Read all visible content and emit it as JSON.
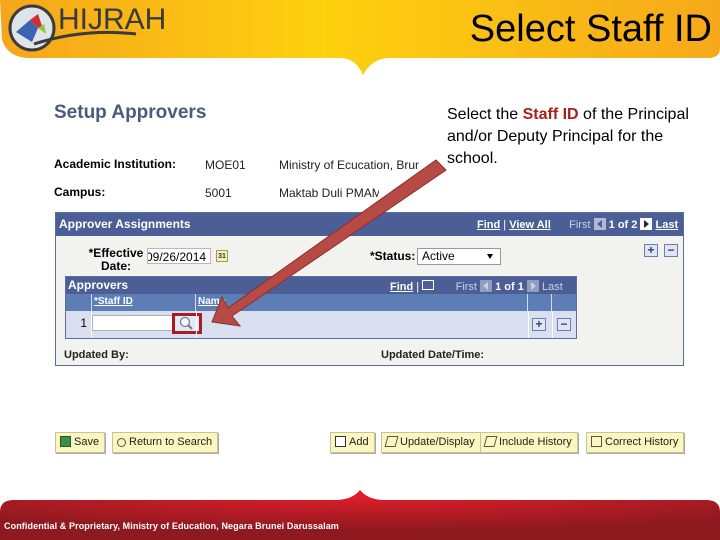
{
  "slide": {
    "logo_text": "HIJRAH",
    "title": "Select Staff ID",
    "footer": "Confidential & Proprietary, Ministry of Education, Negara Brunei Darussalam",
    "callout": {
      "before": "Select the ",
      "highlight": "Staff ID",
      "after": " of the Principal and/or Deputy Principal for the school."
    },
    "colors": {
      "header_yellow": "#fcc30f",
      "footer_red": "#c81e27",
      "highlight_red": "#a8201a",
      "arrow_red": "#b84a45"
    }
  },
  "page": {
    "title": "Setup Approvers",
    "academic_institution": {
      "label": "Academic Institution:",
      "code": "MOE01",
      "name": "Ministry of Ecucation, Brunei"
    },
    "campus": {
      "label": "Campus:",
      "code": "5001",
      "name": "Maktab Duli PMAMB"
    }
  },
  "assignments": {
    "title": "Approver Assignments",
    "find": "Find",
    "view_all": "View All",
    "first": "First",
    "counter": "1 of 2",
    "last": "Last",
    "effective_date_label": "*Effective Date:",
    "effective_date_value": "09/26/2014",
    "calendar_icon_text": "31",
    "status_label": "*Status:",
    "status_value": "Active",
    "add_row": "+",
    "delete_row": "−",
    "updated_by_label": "Updated By:",
    "updated_datetime_label": "Updated Date/Time:"
  },
  "approvers": {
    "title": "Approvers",
    "find": "Find",
    "first": "First",
    "counter": "1 of 1",
    "last": "Last",
    "columns": [
      "*Staff ID",
      "Name"
    ],
    "rows": [
      {
        "num": "1",
        "staff_id": "",
        "name": ""
      }
    ],
    "add_row": "+",
    "delete_row": "−"
  },
  "toolbar": {
    "save": "Save",
    "return_to_search": "Return to Search",
    "add": "Add",
    "update_display": "Update/Display",
    "include_history": "Include History",
    "correct_history": "Correct History"
  }
}
